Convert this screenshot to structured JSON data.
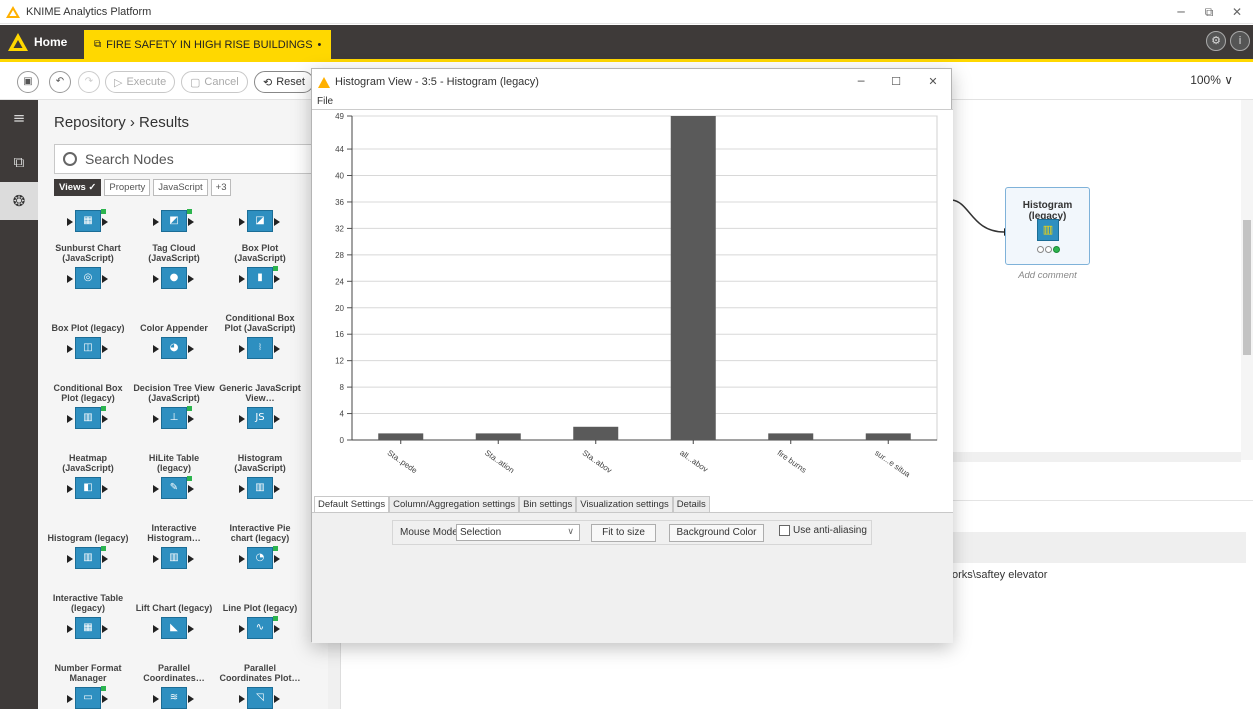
{
  "window": {
    "title": "KNIME Analytics Platform",
    "min_glyph": "─",
    "max_glyph": "⧉",
    "close_glyph": "✕"
  },
  "appbar": {
    "home_label": "Home",
    "workflow_tab": "FIRE SAFETY IN HIGH RISE BUILDINGS",
    "workflow_dot": "•"
  },
  "toolbar": {
    "execute_label": "Execute",
    "cancel_label": "Cancel",
    "reset_label": "Reset",
    "zoom": "100% ∨"
  },
  "repo": {
    "breadcrumb": "Repository › Results",
    "search_placeholder": "Search Nodes",
    "tags": [
      "Views ✓",
      "Property",
      "JavaScript",
      "+3"
    ],
    "nodes": [
      {
        "name": "",
        "icon": "▦"
      },
      {
        "name": "",
        "icon": "◩"
      },
      {
        "name": "",
        "icon": "◪"
      },
      {
        "name": "Sunburst Chart (JavaScript)",
        "icon": "◎"
      },
      {
        "name": "Tag Cloud (JavaScript)",
        "icon": "●"
      },
      {
        "name": "Box Plot (JavaScript)",
        "icon": "▮"
      },
      {
        "name": "Box Plot (legacy)",
        "icon": "◫"
      },
      {
        "name": "Color Appender",
        "icon": "◕"
      },
      {
        "name": "Conditional Box Plot (JavaScript)",
        "icon": "⧘"
      },
      {
        "name": "Conditional Box Plot (legacy)",
        "icon": "▥"
      },
      {
        "name": "Decision Tree View (JavaScript)",
        "icon": "⊥"
      },
      {
        "name": "Generic JavaScript View…",
        "icon": "JS"
      },
      {
        "name": "Heatmap (JavaScript)",
        "icon": "◧"
      },
      {
        "name": "HiLite Table (legacy)",
        "icon": "✎"
      },
      {
        "name": "Histogram (JavaScript)",
        "icon": "▥"
      },
      {
        "name": "Histogram (legacy)",
        "icon": "▥"
      },
      {
        "name": "Interactive Histogram…",
        "icon": "▥"
      },
      {
        "name": "Interactive Pie chart (legacy)",
        "icon": "◔"
      },
      {
        "name": "Interactive Table (legacy)",
        "icon": "▦"
      },
      {
        "name": "Lift Chart (legacy)",
        "icon": "◣"
      },
      {
        "name": "Line Plot (legacy)",
        "icon": "∿"
      },
      {
        "name": "Number Format Manager",
        "icon": "▭"
      },
      {
        "name": "Parallel Coordinates…",
        "icon": "≋"
      },
      {
        "name": "Parallel Coordinates Plot…",
        "icon": "◹"
      }
    ]
  },
  "canvas": {
    "node_title": "Histogram (legacy)",
    "node_icon": "▥",
    "add_comment": "Add comment",
    "partial_letter": "r",
    "path_text": "orks\\saftey elevator"
  },
  "dialog": {
    "title": "Histogram View - 3:5 - Histogram (legacy)",
    "menu_file": "File",
    "tabs": [
      "Default Settings",
      "Column/Aggregation settings",
      "Bin settings",
      "Visualization settings",
      "Details"
    ],
    "mouse_mode_label": "Mouse Mode",
    "mouse_mode_value": "Selection",
    "fit_label": "Fit to size",
    "bg_label": "Background Color",
    "aa_label": "Use anti-aliasing"
  },
  "chart_data": {
    "type": "bar",
    "categories": [
      "Sta..pede",
      "Sta..ation",
      "Sta..abov",
      "all...abov",
      "fire burns",
      "sur...e situa"
    ],
    "values": [
      1,
      1,
      2,
      49,
      1,
      1
    ],
    "ylim": [
      0,
      49
    ],
    "yticks": [
      0,
      4,
      8,
      12,
      16,
      20,
      24,
      28,
      32,
      36,
      40,
      44,
      49
    ],
    "grid": true,
    "bar_color": "#5a5a5a"
  }
}
